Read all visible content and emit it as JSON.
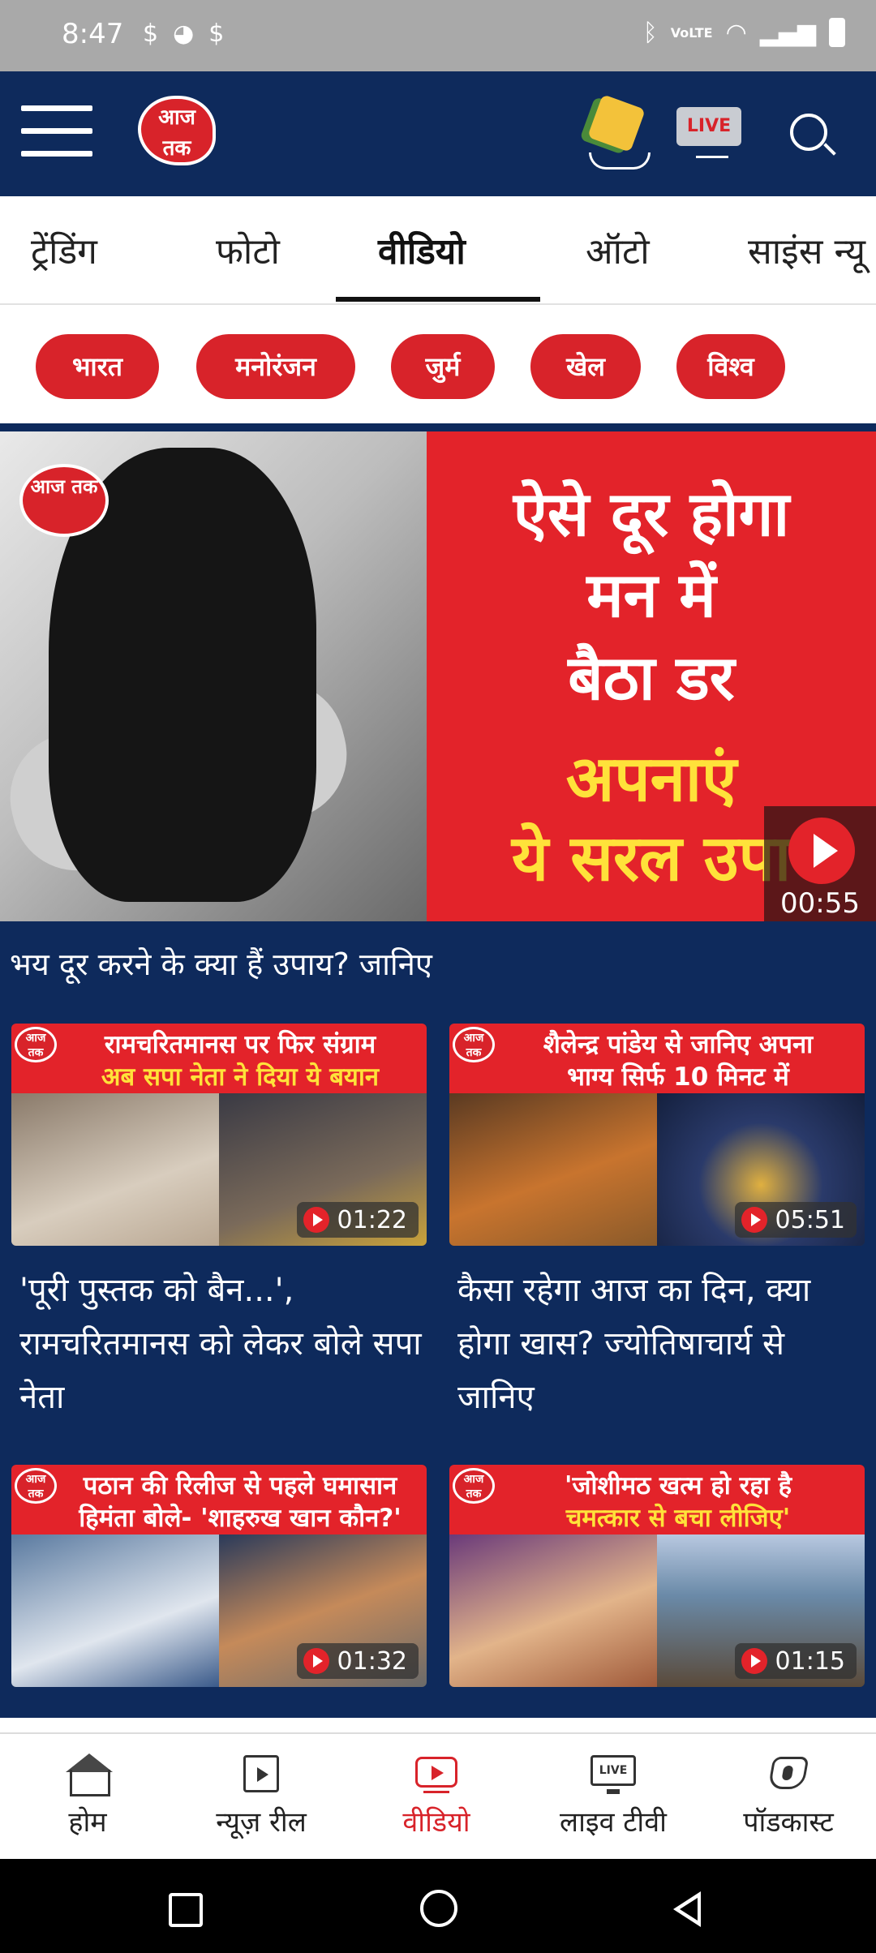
{
  "status_bar": {
    "time": "8:47",
    "left_icons": [
      "sim-icon",
      "app-icon",
      "sim-icon"
    ],
    "right_icons": [
      "bluetooth-icon",
      "volte-icon",
      "wifi-icon",
      "signal-icon",
      "battery-icon"
    ],
    "volte_label": "VoLTE"
  },
  "header": {
    "logo_text": "आज तक",
    "live_label": "LIVE"
  },
  "tabs": [
    {
      "label": "ट्रेंडिंग"
    },
    {
      "label": "फोटो"
    },
    {
      "label": "वीडियो",
      "active": true
    },
    {
      "label": "ऑटो"
    },
    {
      "label": "साइंस न्यू"
    }
  ],
  "chips": [
    "भारत",
    "मनोरंजन",
    "जुर्म",
    "खेल",
    "विश्व"
  ],
  "hero": {
    "logo_text": "आज तक",
    "lines_white": [
      "ऐसे दूर होगा",
      "मन में",
      "बैठा डर"
    ],
    "lines_yellow": [
      "अपनाएं",
      "ये सरल उपा"
    ],
    "duration": "00:55",
    "caption": "भय दूर करने के क्या हैं उपाय? जानिए"
  },
  "cards": [
    {
      "banner_line1": "रामचरितमानस पर फिर संग्राम",
      "banner_line2": "अब सपा नेता ने दिया ये बयान",
      "duration": "01:22",
      "title": "'पूरी पुस्तक को बैन...', रामचरितमानस को लेकर बोले सपा नेता"
    },
    {
      "banner_line1": "शैलेन्द्र पांडेय से जानिए अपना",
      "banner_line2": "भाग्य सिर्फ 10 मिनट में",
      "duration": "05:51",
      "title": "कैसा रहेगा आज का दिन, क्या होगा खास? ज्योतिषाचार्य से जानिए"
    },
    {
      "banner_line1": "पठान की रिलीज से पहले घमासान",
      "banner_line2": "हिमंता बोले- 'शाहरुख खान कौन?'",
      "duration": "01:32",
      "title": ""
    },
    {
      "banner_line1": "'जोशीमठ खत्म हो रहा है",
      "banner_line2": "चमत्कार से बचा लीजिए'",
      "duration": "01:15",
      "title": ""
    }
  ],
  "bottom_nav": [
    {
      "label": "होम",
      "icon": "home-icon"
    },
    {
      "label": "न्यूज़ रील",
      "icon": "film-icon"
    },
    {
      "label": "वीडियो",
      "icon": "video-icon",
      "active": true
    },
    {
      "label": "लाइव टीवी",
      "icon": "tv-icon",
      "icon_text": "LIVE"
    },
    {
      "label": "पॉडकास्ट",
      "icon": "podcast-icon"
    }
  ],
  "colors": {
    "navy": "#0e2a5c",
    "red": "#d8232a",
    "yellow": "#ffe23a"
  }
}
